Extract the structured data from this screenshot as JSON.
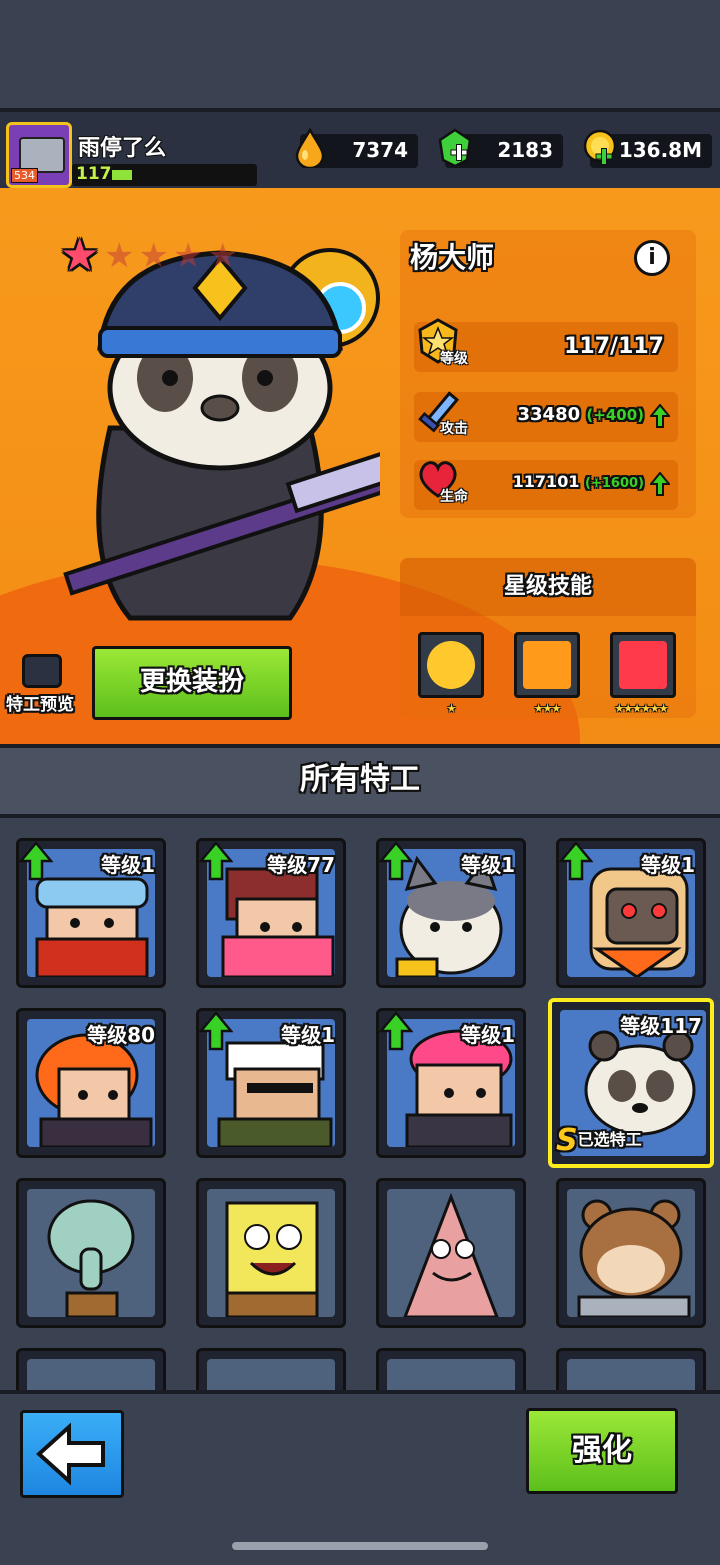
{
  "player": {
    "name": "雨停了么",
    "level": "117",
    "avatar_level": "534"
  },
  "resources": {
    "oil": "7374",
    "gems": "2183",
    "coins": "136.8M"
  },
  "hero": {
    "name": "杨大师",
    "level_label": "等级",
    "level_value": "117/117",
    "attack_label": "攻击",
    "attack_value": "33480",
    "attack_bonus": "(+400)",
    "hp_label": "生命",
    "hp_value": "117101",
    "hp_bonus": "(+1600)",
    "star_level": 1
  },
  "skills": {
    "title": "星级技能",
    "items": [
      {
        "icon": "yin-yang-icon",
        "stars": "★"
      },
      {
        "icon": "fire-spirit-icon",
        "stars": "★★★"
      },
      {
        "icon": "red-flame-icon",
        "stars": "★★★★★★"
      }
    ]
  },
  "buttons": {
    "preview": "特工预览",
    "change_outfit": "更换装扮",
    "upgrade": "强化"
  },
  "list": {
    "title": "所有特工",
    "selected_label": "已选特工",
    "selected_tier": "S",
    "agents": [
      {
        "level": "等级1",
        "upgrade": true,
        "color": "#4a79c6"
      },
      {
        "level": "等级77",
        "upgrade": true,
        "color": "#4a79c6"
      },
      {
        "level": "等级1",
        "upgrade": true,
        "color": "#4a79c6"
      },
      {
        "level": "等级1",
        "upgrade": true,
        "color": "#4a79c6"
      },
      {
        "level": "等级80",
        "upgrade": false,
        "color": "#4a79c6"
      },
      {
        "level": "等级1",
        "upgrade": true,
        "color": "#4a79c6"
      },
      {
        "level": "等级1",
        "upgrade": true,
        "color": "#4a79c6"
      },
      {
        "level": "等级117",
        "upgrade": false,
        "color": "#4a79c6"
      }
    ]
  }
}
